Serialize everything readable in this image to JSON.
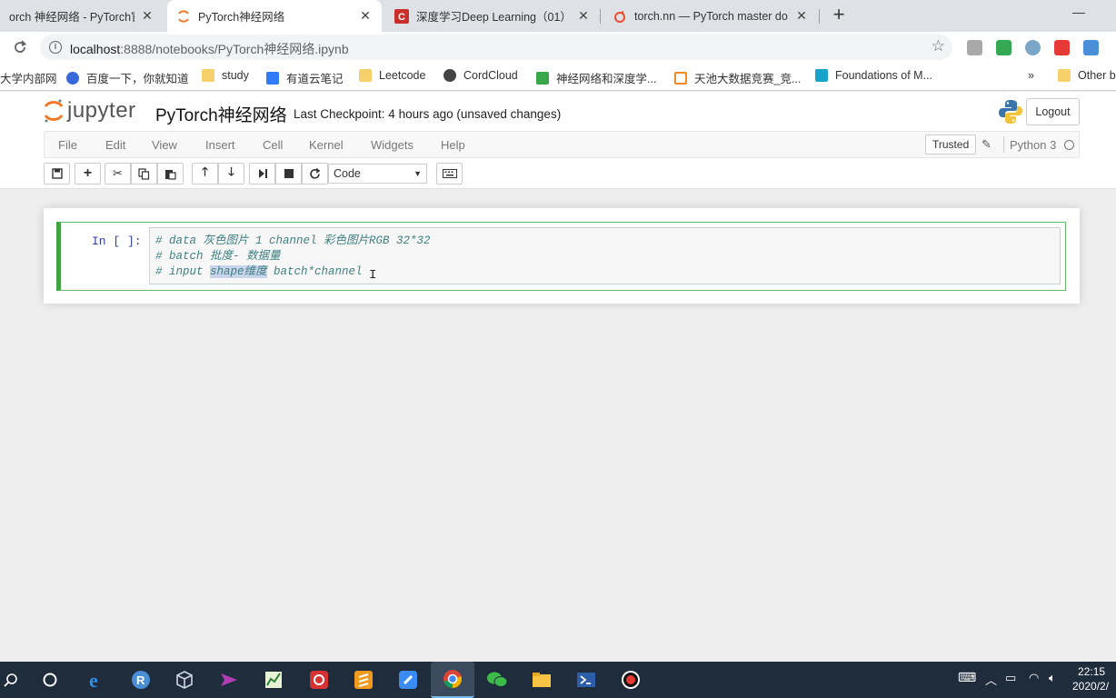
{
  "browser": {
    "tabs": [
      {
        "title": "orch 神经网络 - PyTorch官方",
        "active": false
      },
      {
        "title": "PyTorch神经网络",
        "active": true
      },
      {
        "title": "深度学习Deep Learning（01）",
        "active": false
      },
      {
        "title": "torch.nn — PyTorch master do",
        "active": false
      }
    ],
    "url_host": "localhost",
    "url_rest": ":8888/notebooks/PyTorch神经网络.ipynb",
    "bookmarks": [
      "大学内部网",
      "百度一下，你就知道",
      "study",
      "有道云笔记",
      "Leetcode",
      "CordCloud",
      "神经网络和深度学...",
      "天池大数据竞赛_竞...",
      "Foundations of M...",
      "Other b"
    ],
    "bookmarks_more": "»"
  },
  "jupyter": {
    "logo_text": "jupyter",
    "notebook_name": "PyTorch神经网络",
    "checkpoint": "Last Checkpoint: 4 hours ago (unsaved changes)",
    "logout_label": "Logout",
    "menu": [
      "File",
      "Edit",
      "View",
      "Insert",
      "Cell",
      "Kernel",
      "Widgets",
      "Help"
    ],
    "trusted_label": "Trusted",
    "kernel_name": "Python 3",
    "cell_type": "Code"
  },
  "cell": {
    "prompt": "In [ ]:",
    "lines": [
      {
        "text": "# data 灰色图片 1 channel 彩色图片RGB 32*32"
      },
      {
        "text": "# batch 批度- 数据量"
      },
      {
        "pre": "# input ",
        "selected": "shape维度",
        "post": " batch*channel"
      }
    ]
  },
  "taskbar": {
    "time": "22:15",
    "date": "2020/2/"
  },
  "colors": {
    "cell_border": "#66bb6a",
    "prompt": "#303f9f",
    "comment": "#408080",
    "taskbar": "#1f2c3b"
  }
}
